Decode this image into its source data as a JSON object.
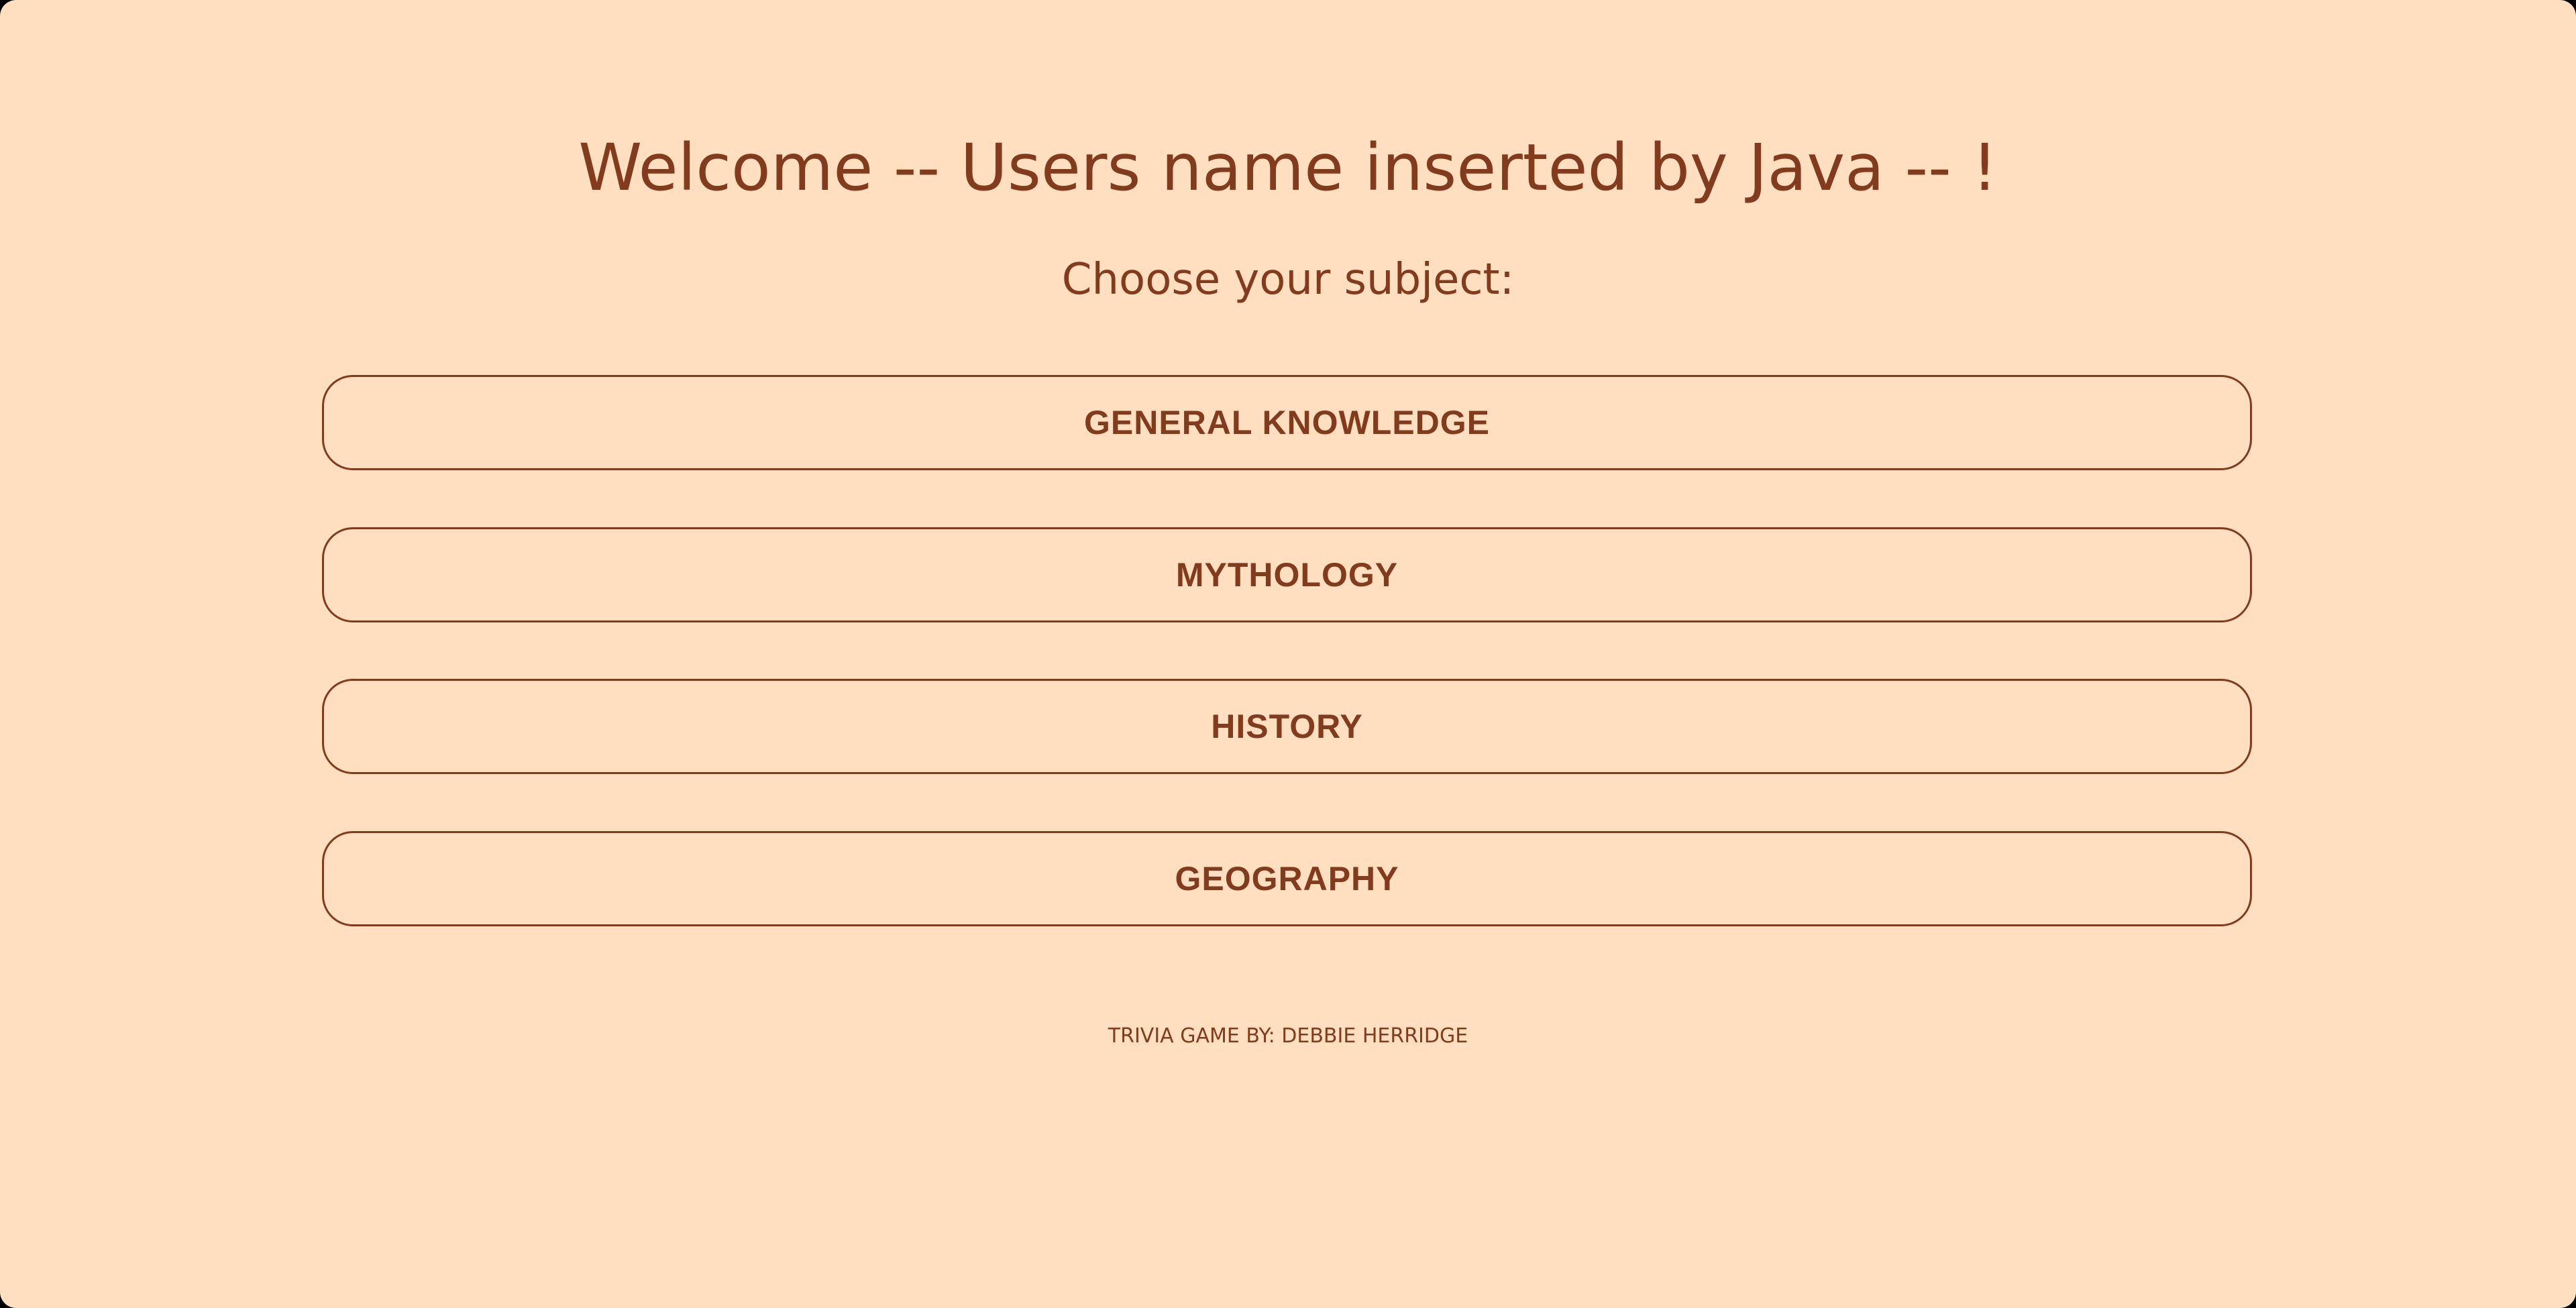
{
  "header": {
    "welcome": "Welcome -- Users name inserted by Java -- !",
    "prompt": "Choose your subject:"
  },
  "subjects": [
    {
      "label": "GENERAL KNOWLEDGE"
    },
    {
      "label": "MYTHOLOGY"
    },
    {
      "label": "HISTORY"
    },
    {
      "label": "GEOGRAPHY"
    }
  ],
  "footer": {
    "credit": "TRIVIA GAME BY: DEBBIE HERRIDGE"
  },
  "colors": {
    "background": "#ffdfbf",
    "text": "#823b1c",
    "border": "#823b1c"
  }
}
